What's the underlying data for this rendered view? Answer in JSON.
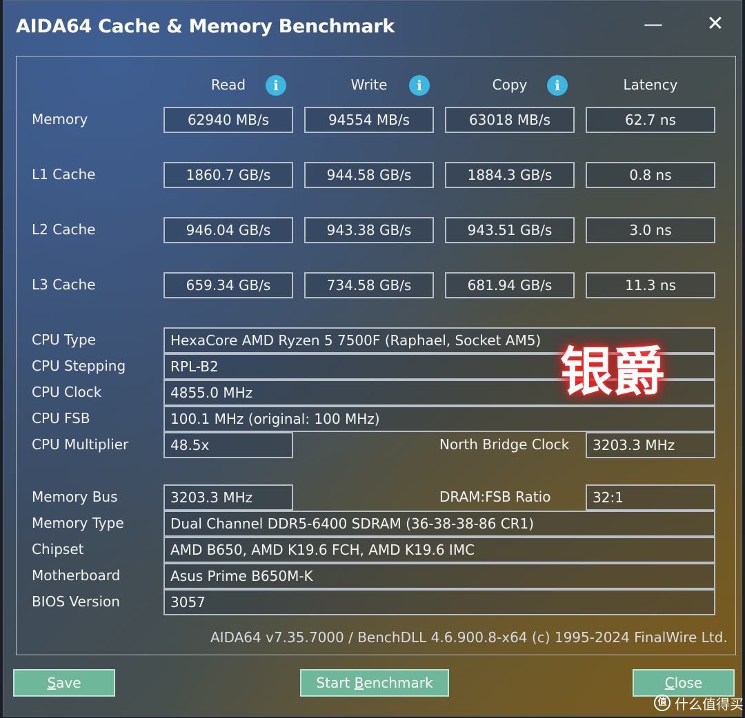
{
  "window": {
    "title": "AIDA64 Cache & Memory Benchmark",
    "minimize_glyph": "—",
    "close_glyph": "✕"
  },
  "headers": {
    "read": "Read",
    "write": "Write",
    "copy": "Copy",
    "latency": "Latency",
    "info_glyph": "i"
  },
  "rows": [
    {
      "label": "Memory",
      "read": "62940 MB/s",
      "write": "94554 MB/s",
      "copy": "63018 MB/s",
      "latency": "62.7 ns"
    },
    {
      "label": "L1 Cache",
      "read": "1860.7 GB/s",
      "write": "944.58 GB/s",
      "copy": "1884.3 GB/s",
      "latency": "0.8 ns"
    },
    {
      "label": "L2 Cache",
      "read": "946.04 GB/s",
      "write": "943.38 GB/s",
      "copy": "943.51 GB/s",
      "latency": "3.0 ns"
    },
    {
      "label": "L3 Cache",
      "read": "659.34 GB/s",
      "write": "734.58 GB/s",
      "copy": "681.94 GB/s",
      "latency": "11.3 ns"
    }
  ],
  "cpu": {
    "type_label": "CPU Type",
    "type": "HexaCore AMD Ryzen 5 7500F  (Raphael, Socket AM5)",
    "stepping_label": "CPU Stepping",
    "stepping": "RPL-B2",
    "clock_label": "CPU Clock",
    "clock": "4855.0 MHz",
    "fsb_label": "CPU FSB",
    "fsb": "100.1 MHz  (original: 100 MHz)",
    "multiplier_label": "CPU Multiplier",
    "multiplier": "48.5x",
    "nb_clock_label": "North Bridge Clock",
    "nb_clock": "3203.3 MHz"
  },
  "memory": {
    "bus_label": "Memory Bus",
    "bus": "3203.3 MHz",
    "ratio_label": "DRAM:FSB Ratio",
    "ratio": "32:1",
    "type_label": "Memory Type",
    "type": "Dual Channel DDR5-6400 SDRAM  (36-38-38-86 CR1)",
    "chipset_label": "Chipset",
    "chipset": "AMD B650, AMD K19.6 FCH, AMD K19.6 IMC",
    "motherboard_label": "Motherboard",
    "motherboard": "Asus Prime B650M-K",
    "bios_label": "BIOS Version",
    "bios": "3057"
  },
  "footer": "AIDA64 v7.35.7000 / BenchDLL 4.6.900.8-x64  (c) 1995-2024 FinalWire Ltd.",
  "buttons": {
    "save_u": "S",
    "save_rest": "ave",
    "start_pre": "Start ",
    "start_u": "B",
    "start_rest": "enchmark",
    "close_u": "C",
    "close_rest": "lose"
  },
  "overlay": {
    "watermark": "银爵",
    "site_logo_glyph": "值",
    "site_logo_text": "什么值得买"
  },
  "colors": {
    "button_bg": "#6fb79b",
    "info_icon": "#3db6e0",
    "watermark_glow": "#ff2a2a"
  }
}
